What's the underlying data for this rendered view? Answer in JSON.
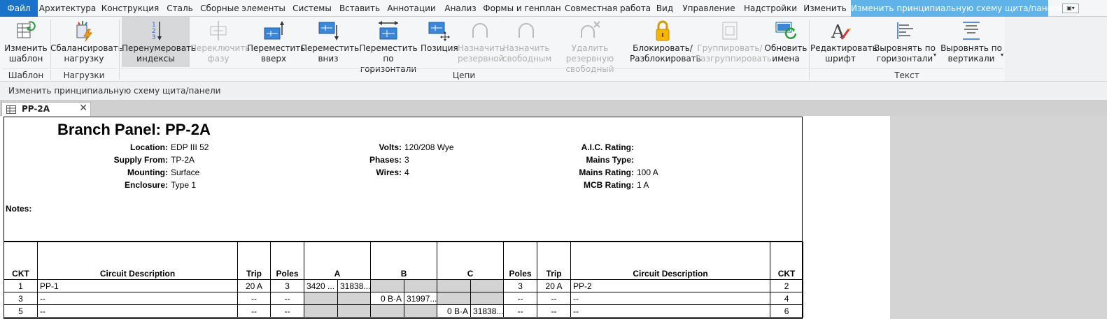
{
  "menu": {
    "tabs": [
      "Файл",
      "Архитектура",
      "Конструкция",
      "Сталь",
      "Сборные элементы",
      "Системы",
      "Вставить",
      "Аннотации",
      "Анализ",
      "Формы и генплан",
      "Совместная работа",
      "Вид",
      "Управление",
      "Надстройки",
      "Изменить",
      "Изменить принципиальную схему щита/панели"
    ],
    "qat_glyph": "▣▾"
  },
  "ribbon": {
    "buttons": [
      {
        "label": "Изменить\nшаблон",
        "icon": "edit-template-icon"
      },
      {
        "label": "Сбалансировать\nнагрузку",
        "icon": "balance-load-icon"
      },
      {
        "label": "Перенумеровать\nиндексы",
        "icon": "renumber-icon"
      },
      {
        "label": "Переключить\nфазу",
        "icon": "switch-phase-icon"
      },
      {
        "label": "Переместить\nвверх",
        "icon": "move-up-icon"
      },
      {
        "label": "Переместить\nвниз",
        "icon": "move-down-icon"
      },
      {
        "label": "Переместить\nпо горизонтали",
        "icon": "move-horizontal-icon"
      },
      {
        "label": "Позиция",
        "icon": "position-icon"
      },
      {
        "label": "Назначить\nрезервной",
        "icon": "assign-spare-icon"
      },
      {
        "label": "Назначить\nсвободным",
        "icon": "assign-space-icon"
      },
      {
        "label": "Удалить резервную\nсвободный",
        "icon": "remove-spare-icon"
      },
      {
        "label": "Блокировать/\nРазблокировать",
        "icon": "lock-icon"
      },
      {
        "label": "Группировать/\nРазгруппировать",
        "icon": "group-icon"
      },
      {
        "label": "Обновить\nимена",
        "icon": "update-names-icon"
      },
      {
        "label": "Редактировать\nшрифт",
        "icon": "edit-font-icon"
      },
      {
        "label": "Выровнять по\nгоризонтали",
        "icon": "align-horizontal-icon"
      },
      {
        "label": "Выровнять по\nвертикали",
        "icon": "align-vertical-icon"
      }
    ],
    "groups": [
      "Шаблон",
      "Нагрузки",
      "Цепи",
      "Текст"
    ]
  },
  "hint": "Изменить принципиальную схему щита/панели",
  "view_tab": {
    "name": "PP-2A",
    "close": "✕"
  },
  "panel": {
    "title": "Branch Panel: PP-2A",
    "fields": {
      "location": {
        "label": "Location:",
        "value": "EDP III 52"
      },
      "supply_from": {
        "label": "Supply From:",
        "value": "TP-2A"
      },
      "mounting": {
        "label": "Mounting:",
        "value": "Surface"
      },
      "enclosure": {
        "label": "Enclosure:",
        "value": "Type 1"
      },
      "volts": {
        "label": "Volts:",
        "value": "120/208 Wye"
      },
      "phases": {
        "label": "Phases:",
        "value": "3"
      },
      "wires": {
        "label": "Wires:",
        "value": "4"
      },
      "aic": {
        "label": "A.I.C. Rating:",
        "value": ""
      },
      "mains_type": {
        "label": "Mains Type:",
        "value": ""
      },
      "mains_rating": {
        "label": "Mains Rating:",
        "value": "100 A"
      },
      "mcb_rating": {
        "label": "MCB Rating:",
        "value": "1 A"
      }
    },
    "notes_label": "Notes:"
  },
  "table": {
    "headers": [
      "CKT",
      "Circuit Description",
      "Trip",
      "Poles",
      "A",
      "B",
      "C",
      "Poles",
      "Trip",
      "Circuit Description",
      "CKT"
    ],
    "rows": [
      [
        "1",
        "PP-1",
        "20 A",
        "3",
        "3420 ...",
        "31838...",
        "",
        "",
        "",
        "",
        "3",
        "20 A",
        "PP-2",
        "2"
      ],
      [
        "3",
        "--",
        "--",
        "--",
        "",
        "",
        "0 B·A",
        "31997...",
        "",
        "",
        "--",
        "--",
        "--",
        "4"
      ],
      [
        "5",
        "--",
        "--",
        "--",
        "",
        "",
        "",
        "",
        "0 B·A",
        "31838...",
        "--",
        "--",
        "--",
        "6"
      ]
    ]
  }
}
